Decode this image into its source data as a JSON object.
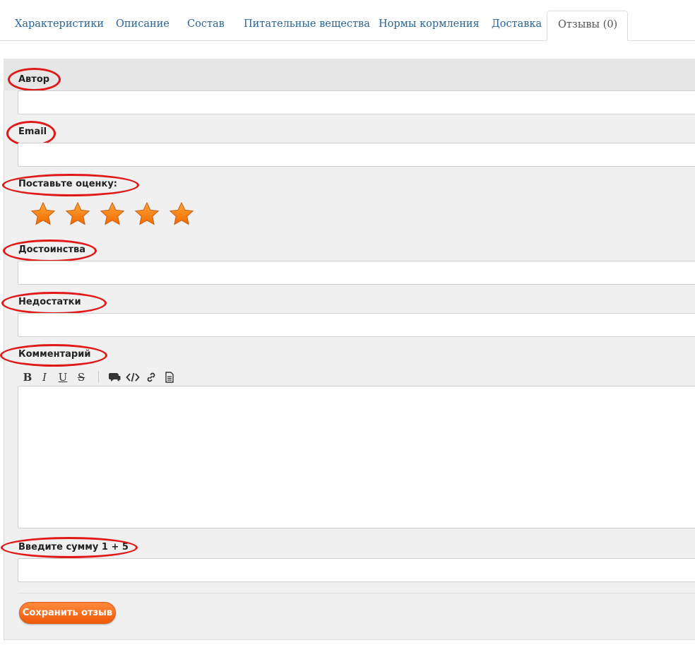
{
  "tabs": [
    {
      "label": "Характеристики",
      "active": false
    },
    {
      "label": "Описание",
      "active": false
    },
    {
      "label": "Состав",
      "active": false
    },
    {
      "label": "Питательные вещества",
      "active": false
    },
    {
      "label": "Нормы кормления",
      "active": false
    },
    {
      "label": "Доставка",
      "active": false
    },
    {
      "label": "Отзывы (0)",
      "active": true
    }
  ],
  "form": {
    "author_label": "Автор",
    "author_value": "",
    "email_label": "Email",
    "email_value": "",
    "rating_label": "Поставьте оценку:",
    "rating": {
      "stars_total": 5,
      "star_color": "#ff7a00"
    },
    "pros_label": "Достоинства",
    "pros_value": "",
    "cons_label": "Недостатки",
    "cons_value": "",
    "comment_label": "Комментарий",
    "comment_value": "",
    "toolbar": {
      "bold": "B",
      "italic": "I",
      "underline": "U",
      "strike": "S",
      "icons": [
        "quote-icon",
        "code-icon",
        "link-icon",
        "document-icon"
      ]
    },
    "captcha_label": "Введите сумму 1 + 5",
    "captcha_value": "",
    "save_label": "Сохранить отзыв"
  },
  "colors": {
    "tab_link": "#2a6496",
    "annotation": "#e01818",
    "button": "#f36a16"
  }
}
